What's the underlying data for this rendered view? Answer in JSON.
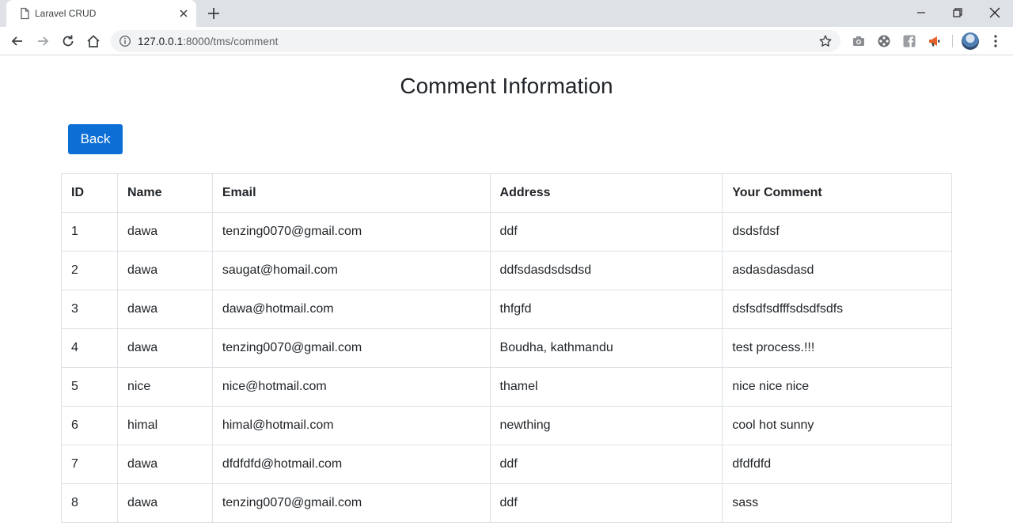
{
  "browser": {
    "tab_title": "Laravel CRUD",
    "url_host": "127.0.0.1",
    "url_rest": ":8000/tms/comment"
  },
  "page": {
    "heading": "Comment Information",
    "back_label": "Back"
  },
  "table": {
    "headers": [
      "ID",
      "Name",
      "Email",
      "Address",
      "Your Comment"
    ],
    "rows": [
      [
        "1",
        "dawa",
        "tenzing0070@gmail.com",
        "ddf",
        "dsdsfdsf"
      ],
      [
        "2",
        "dawa",
        "saugat@homail.com",
        "ddfsdasdsdsdsd",
        "asdasdasdasd"
      ],
      [
        "3",
        "dawa",
        "dawa@hotmail.com",
        "thfgfd",
        "dsfsdfsdfffsdsdfsdfs"
      ],
      [
        "4",
        "dawa",
        "tenzing0070@gmail.com",
        "Boudha, kathmandu",
        "test process.!!!"
      ],
      [
        "5",
        "nice",
        "nice@hotmail.com",
        "thamel",
        "nice nice nice"
      ],
      [
        "6",
        "himal",
        "himal@hotmail.com",
        "newthing",
        "cool hot sunny"
      ],
      [
        "7",
        "dawa",
        "dfdfdfd@hotmail.com",
        "ddf",
        "dfdfdfd"
      ],
      [
        "8",
        "dawa",
        "tenzing0070@gmail.com",
        "ddf",
        "sass"
      ]
    ]
  },
  "colors": {
    "primary_button": "#0d6fd6",
    "tabstrip": "#dee1e6",
    "table_border": "#dee2e6"
  }
}
